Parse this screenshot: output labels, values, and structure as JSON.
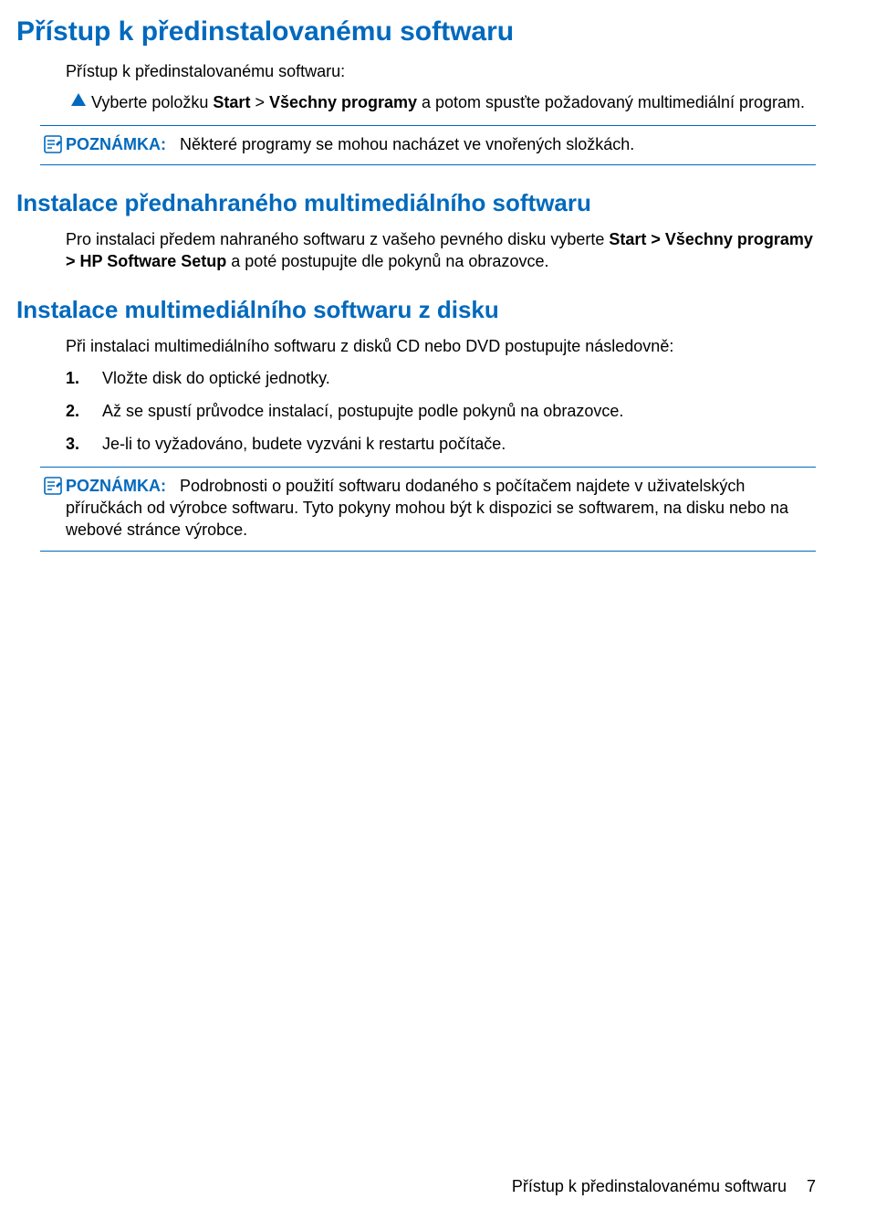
{
  "section1": {
    "title": "Přístup k předinstalovanému softwaru",
    "intro": "Přístup k předinstalovanému softwaru:",
    "step_pre": "Vyberte položku ",
    "step_b1": "Start",
    "step_mid": " > ",
    "step_b2": "Všechny programy",
    "step_post": " a potom spusťte požadovaný multimediální program.",
    "note_label": "POZNÁMKA:",
    "note_text": "Některé programy se mohou nacházet ve vnořených složkách."
  },
  "section2": {
    "title": "Instalace přednahraného multimediálního softwaru",
    "para_pre": "Pro instalaci předem nahraného softwaru z vašeho pevného disku vyberte ",
    "para_b": "Start > Všechny programy > HP Software Setup",
    "para_post": " a poté postupujte dle pokynů na obrazovce."
  },
  "section3": {
    "title": "Instalace multimediálního softwaru z disku",
    "intro": "Při instalaci multimediálního softwaru z disků CD nebo DVD postupujte následovně:",
    "steps": [
      {
        "num": "1.",
        "text": "Vložte disk do optické jednotky."
      },
      {
        "num": "2.",
        "text": "Až se spustí průvodce instalací, postupujte podle pokynů na obrazovce."
      },
      {
        "num": "3.",
        "text": "Je-li to vyžadováno, budete vyzváni k restartu počítače."
      }
    ],
    "note_label": "POZNÁMKA:",
    "note_text": "Podrobnosti o použití softwaru dodaného s počítačem najdete v uživatelských příručkách od výrobce softwaru. Tyto pokyny mohou být k dispozici se softwarem, na disku nebo na webové stránce výrobce."
  },
  "footer": {
    "title": "Přístup k předinstalovanému softwaru",
    "page": "7"
  }
}
